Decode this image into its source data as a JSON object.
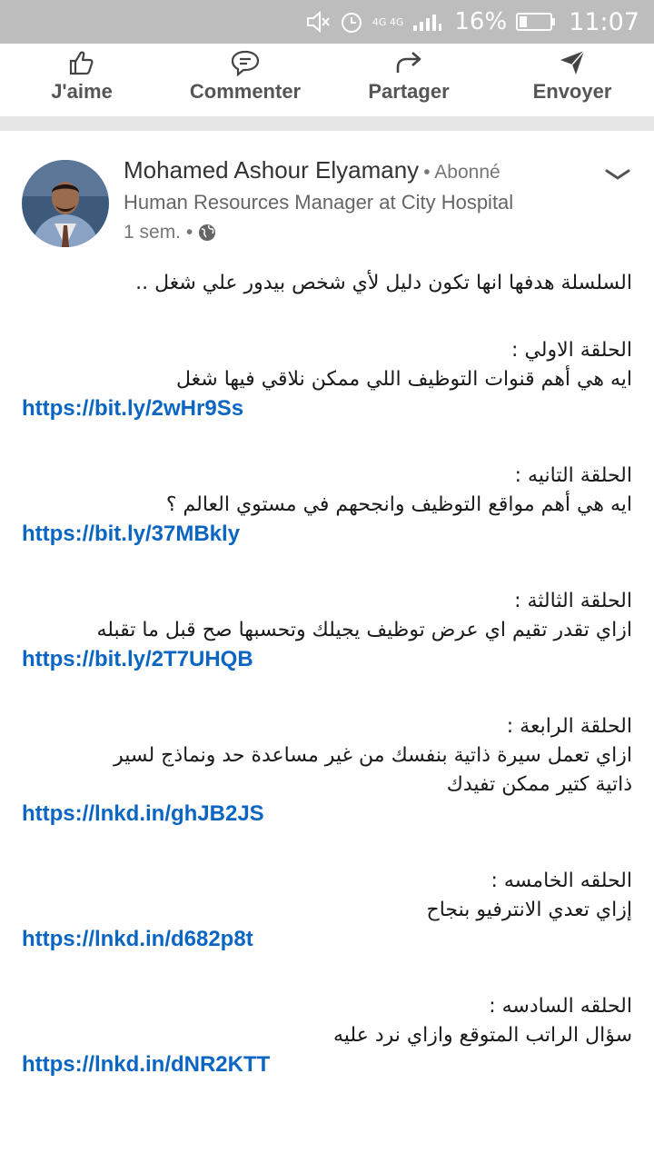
{
  "status_bar": {
    "network": "4G 4G",
    "battery": "16%",
    "time": "11:07",
    "icons": [
      "mute-icon",
      "alarm-icon",
      "signal-icon",
      "battery-icon"
    ]
  },
  "actions": [
    {
      "label": "J'aime",
      "icon": "thumbs-up-icon"
    },
    {
      "label": "Commenter",
      "icon": "comment-icon"
    },
    {
      "label": "Partager",
      "icon": "share-arrow-icon"
    },
    {
      "label": "Envoyer",
      "icon": "send-icon"
    }
  ],
  "post": {
    "author": "Mohamed Ashour Elyamany",
    "follow_status": "• Abonné",
    "headline": "Human Resources Manager at City Hospital",
    "time": "1 sem. •",
    "intro": [
      "السلسلة هدفها انها تكون دليل لأي شخص بيدور علي شغل .."
    ],
    "episodes": [
      {
        "title": "الحلقة الاولي :",
        "lines": [
          "ايه هي أهم قنوات التوظيف اللي ممكن نلاقي فيها شغل"
        ],
        "link": "https://bit.ly/2wHr9Ss"
      },
      {
        "title": "الحلقة التانيه :",
        "lines": [
          "ايه هي أهم مواقع التوظيف وانجحهم في مستوي العالم ؟"
        ],
        "link": "https://bit.ly/37MBkly"
      },
      {
        "title": "الحلقة الثالثة :",
        "lines": [
          "ازاي تقدر تقيم اي عرض توظيف يجيلك وتحسبها صح قبل ما تقبله"
        ],
        "link": "https://bit.ly/2T7UHQB"
      },
      {
        "title": "الحلقة الرابعة :",
        "lines": [
          "ازاي تعمل سيرة ذاتية بنفسك من غير مساعدة حد ونماذج لسير",
          "ذاتية كتير ممكن تفيدك"
        ],
        "link": "https://lnkd.in/ghJB2JS"
      },
      {
        "title": "الحلقه الخامسه :",
        "lines": [
          "إزاي تعدي الانترفيو بنجاح"
        ],
        "link": "https://lnkd.in/d682p8t"
      },
      {
        "title": "الحلقه السادسه :",
        "lines": [
          "سؤال الراتب المتوقع وازاي نرد عليه"
        ],
        "link": "https://lnkd.in/dNR2KTT"
      }
    ]
  },
  "colors": {
    "link": "#0a66c2",
    "status_bar": "#bdbdbd",
    "separator": "#e6e6e6"
  }
}
